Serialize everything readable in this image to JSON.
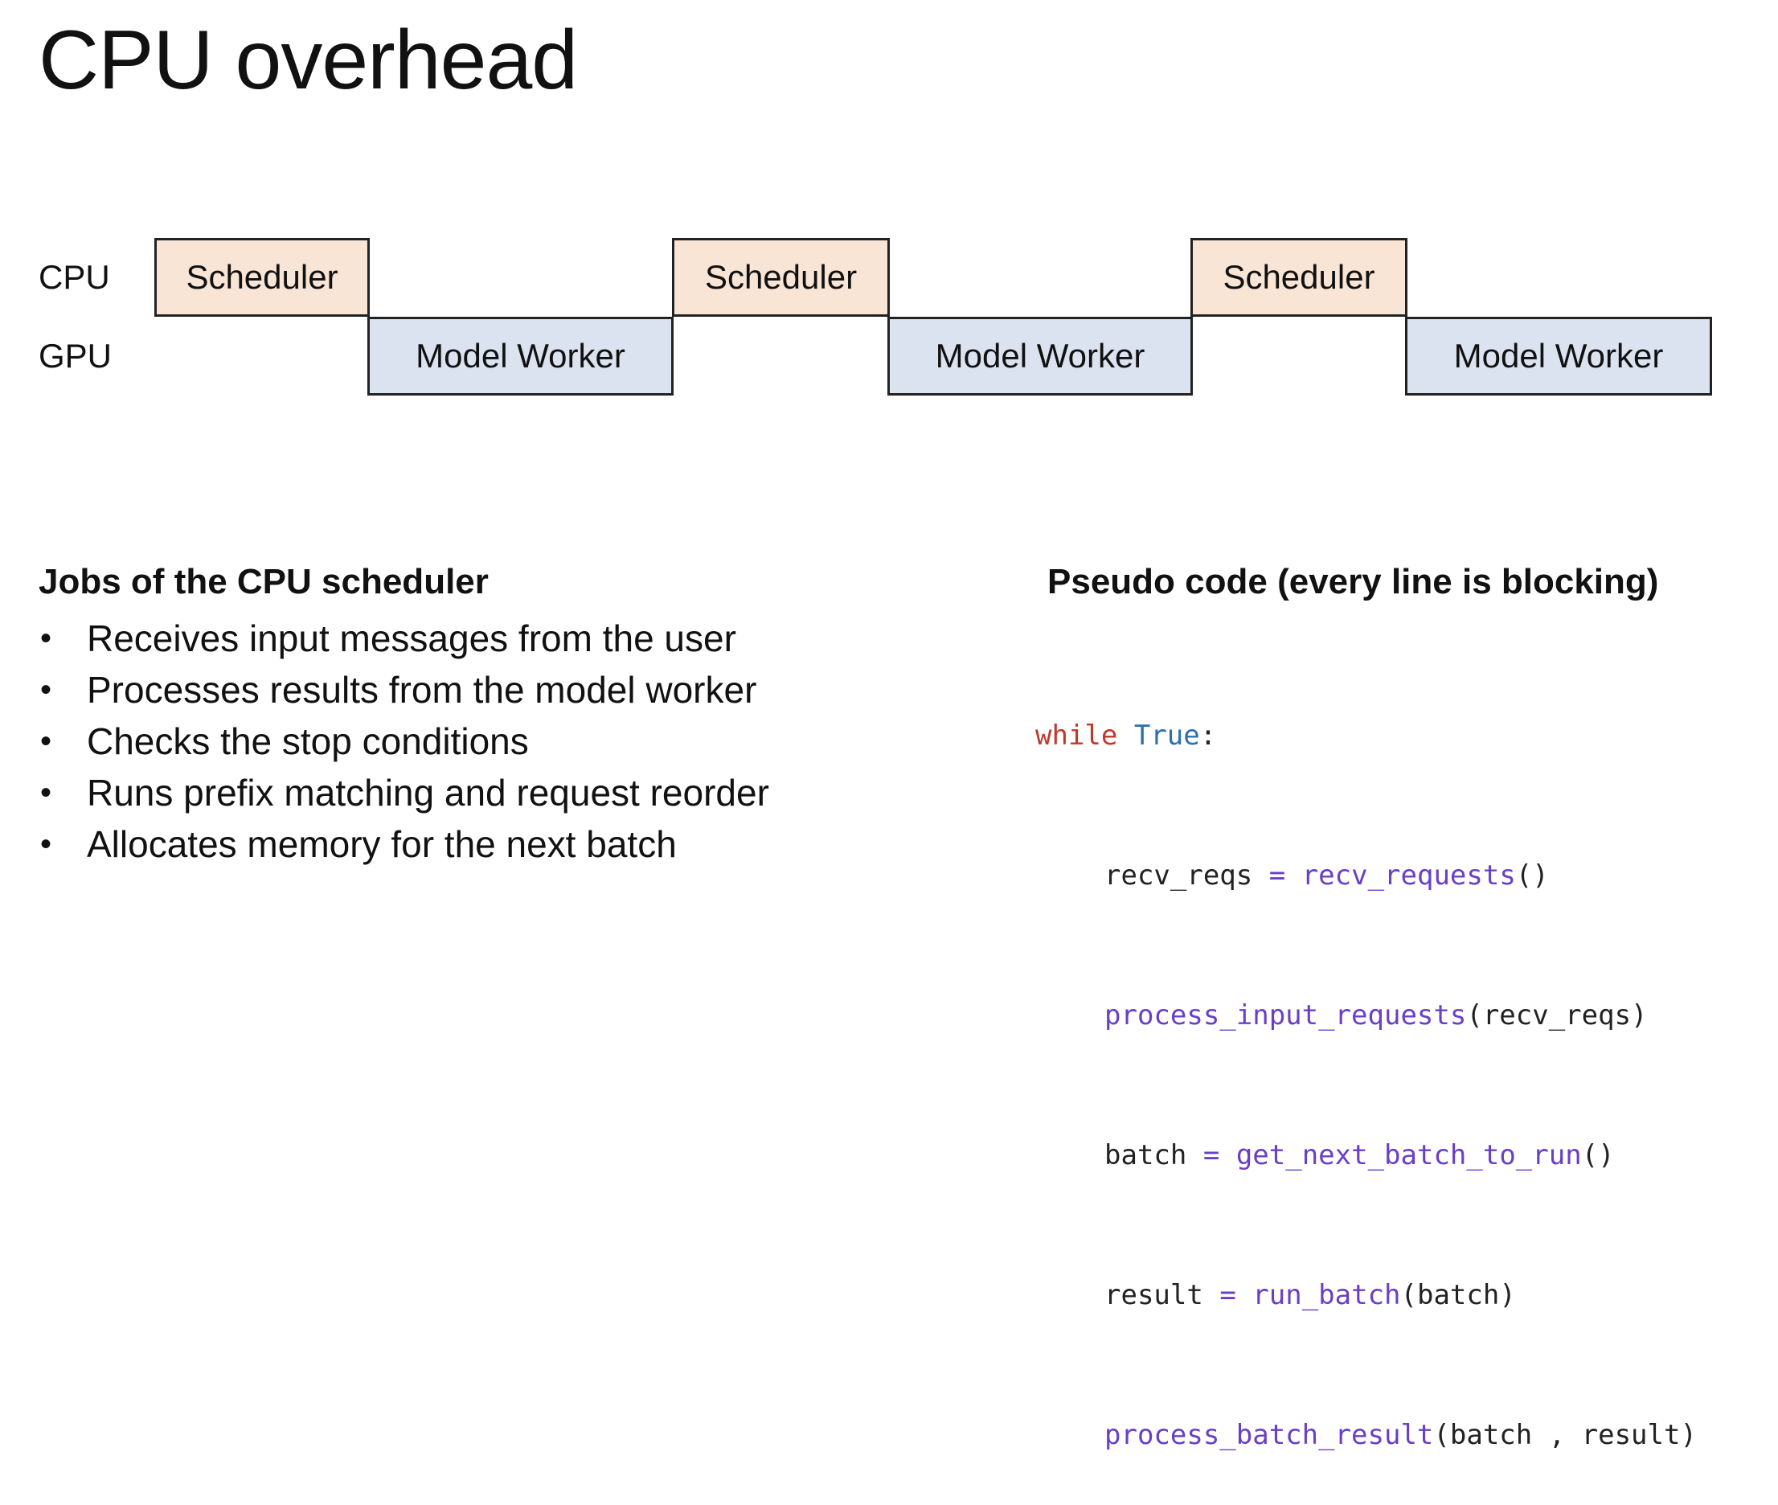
{
  "title": "CPU overhead",
  "timeline": {
    "row_labels": {
      "cpu": "CPU",
      "gpu": "GPU"
    },
    "scheduler_label": "Scheduler",
    "worker_label": "Model Worker",
    "colors": {
      "scheduler_fill": "#f8e5d6",
      "worker_fill": "#dce3f0",
      "border": "#222222"
    }
  },
  "jobs": {
    "heading": "Jobs of the CPU scheduler",
    "bullet": "•",
    "items": [
      "Receives input messages from the user",
      "Processes results from the model worker",
      "Checks the stop conditions",
      "Runs prefix matching and request reorder",
      "Allocates memory for the next batch"
    ]
  },
  "code": {
    "heading": "Pseudo code (every line is blocking)",
    "while_kw": "while",
    "true_kw": "True",
    "colon": ":",
    "lines": {
      "l1_var": "recv_reqs",
      "l1_eq": "=",
      "l1_fn": "recv_requests",
      "l1_args": "()",
      "l2_fn": "process_input_requests",
      "l2_args": "(recv_reqs)",
      "l3_var": "batch",
      "l3_eq": "=",
      "l3_fn": "get_next_batch_to_run",
      "l3_args": "()",
      "l4_var": "result",
      "l4_eq": "=",
      "l4_fn": "run_batch",
      "l4_args": "(batch)",
      "l5_fn": "process_batch_result",
      "l5_args": "(batch , result)"
    },
    "colors": {
      "keyword_while": "#c0392b",
      "keyword_true": "#2e6fb0",
      "function": "#6a3fc8"
    }
  }
}
